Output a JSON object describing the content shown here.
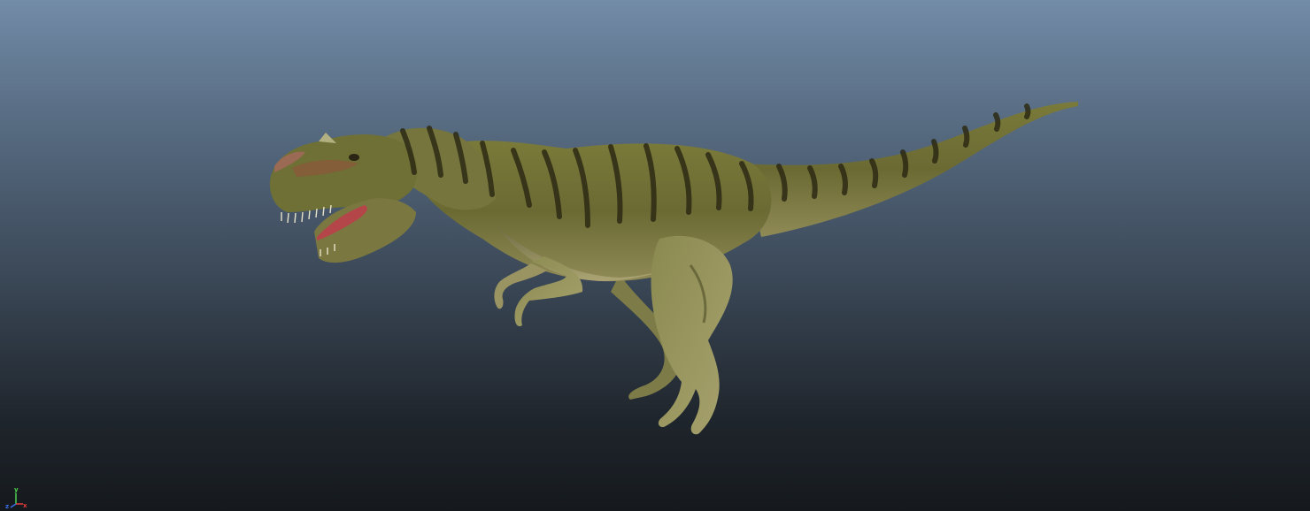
{
  "viewport": {
    "background_top": "#728ba7",
    "background_bottom": "#15191d",
    "model": "dinosaur-model"
  },
  "axis_gizmo": {
    "x_label": "x",
    "y_label": "y",
    "z_label": "z",
    "x_color": "#e83a3a",
    "y_color": "#4ed14e",
    "z_color": "#3a6ee8"
  }
}
